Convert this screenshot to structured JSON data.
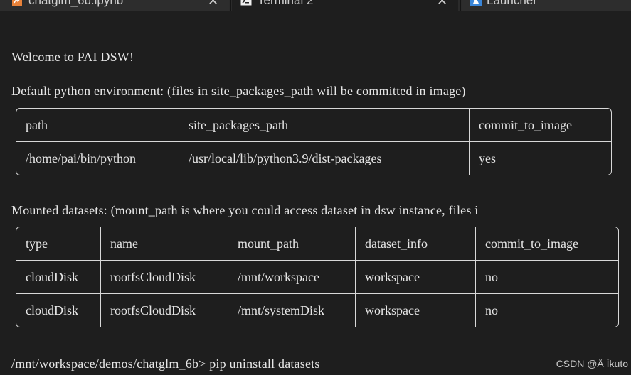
{
  "tabs": [
    {
      "label": "chatglm_6b.ipynb",
      "icon": "notebook-icon",
      "active": false
    },
    {
      "label": "Terminal 2",
      "icon": "terminal-icon",
      "active": true
    },
    {
      "label": "Launcher",
      "icon": "launcher-icon",
      "active": false
    }
  ],
  "close_glyph": "✕",
  "terminal": {
    "welcome": "Welcome to PAI DSW!",
    "default_env_heading": "Default python environment: (files in site_packages_path will be committed in image)",
    "env_table": {
      "headers": [
        "path",
        "site_packages_path",
        "commit_to_image"
      ],
      "rows": [
        [
          "/home/pai/bin/python",
          "/usr/local/lib/python3.9/dist-packages",
          "yes"
        ]
      ]
    },
    "mounted_heading": "Mounted datasets: (mount_path is where you could access dataset in dsw instance, files i",
    "datasets_table": {
      "headers": [
        "type",
        "name",
        "mount_path",
        "dataset_info",
        "commit_to_image"
      ],
      "rows": [
        [
          "cloudDisk",
          "rootfsCloudDisk",
          "/mnt/workspace",
          "workspace",
          "no"
        ],
        [
          "cloudDisk",
          "rootfsCloudDisk",
          "/mnt/systemDisk",
          "workspace",
          "no"
        ]
      ]
    },
    "prompt": "/mnt/workspace/demos/chatglm_6b>",
    "command": " pip uninstall datasets"
  },
  "watermark": "CSDN @Å Ĭkuto",
  "colors": {
    "background": "#1e1e1e",
    "text": "#e6e6e6",
    "tab_bar": "#2b2b2b"
  }
}
